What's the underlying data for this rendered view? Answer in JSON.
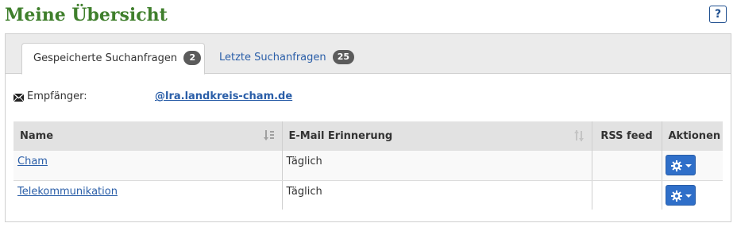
{
  "page": {
    "title": "Meine Übersicht",
    "help_label": "?"
  },
  "tabs": [
    {
      "label": "Gespeicherte Suchanfragen",
      "count": "2",
      "active": true
    },
    {
      "label": "Letzte Suchanfragen",
      "count": "25",
      "active": false
    }
  ],
  "recipient": {
    "label": "Empfänger:",
    "value": "@lra.landkreis-cham.de",
    "icon": "envelope-icon"
  },
  "table": {
    "headers": {
      "name": "Name",
      "email_reminder": "E-Mail Erinnerung",
      "rss": "RSS feed",
      "actions": "Aktionen"
    },
    "rows": [
      {
        "name": "Cham",
        "email_reminder": "Täglich",
        "rss": ""
      },
      {
        "name": "Telekommunikation",
        "email_reminder": "Täglich",
        "rss": ""
      }
    ]
  },
  "colors": {
    "title_green": "#3f7f2c",
    "link_blue": "#2a5ea8",
    "action_blue": "#2f6fc9",
    "badge_gray": "#5b5b5b"
  }
}
